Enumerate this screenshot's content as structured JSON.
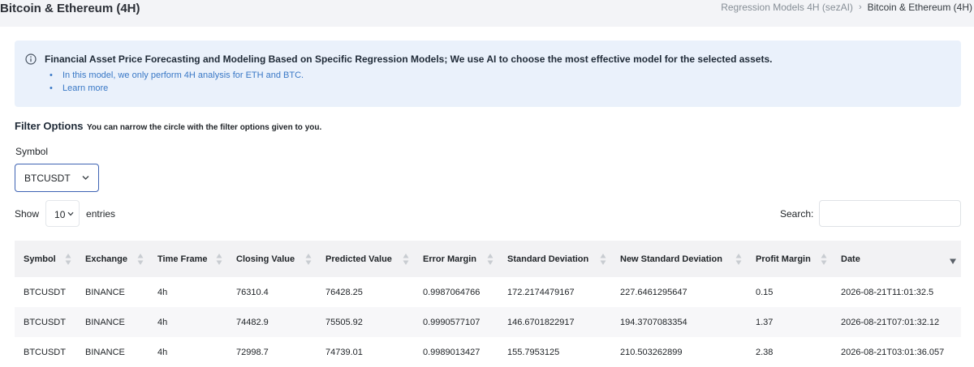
{
  "header": {
    "title": "Bitcoin & Ethereum (4H)",
    "breadcrumb": {
      "parent": "Regression Models 4H (sezAI)",
      "separator": "›",
      "current": "Bitcoin & Ethereum (4H)"
    }
  },
  "alert": {
    "icon": "info-circle-icon",
    "title": "Financial Asset Price Forecasting and Modeling Based on Specific Regression Models; We use AI to choose the most effective model for the selected assets.",
    "items": [
      "In this model, we only perform 4H analysis for ETH and BTC.",
      "Learn more"
    ]
  },
  "filter": {
    "title": "Filter Options",
    "description": "You can narrow the circle with the filter options given to you.",
    "symbol_label": "Symbol",
    "symbol_value": "BTCUSDT"
  },
  "table_controls": {
    "show_label": "Show",
    "page_length": "10",
    "entries_label": "entries",
    "search_label": "Search:",
    "search_value": ""
  },
  "table": {
    "columns": [
      "Symbol",
      "Exchange",
      "Time Frame",
      "Closing Value",
      "Predicted Value",
      "Error Margin",
      "Standard Deviation",
      "New Standard Deviation",
      "Profit Margin",
      "Date"
    ],
    "rows": [
      [
        "BTCUSDT",
        "BINANCE",
        "4h",
        "76310.4",
        "76428.25",
        "0.9987064766",
        "172.2174479167",
        "227.6461295647",
        "0.15",
        "2026-08-21T11:01:32.5"
      ],
      [
        "BTCUSDT",
        "BINANCE",
        "4h",
        "74482.9",
        "75505.92",
        "0.9990577107",
        "146.6701822917",
        "194.3707083354",
        "1.37",
        "2026-08-21T07:01:32.12"
      ],
      [
        "BTCUSDT",
        "BINANCE",
        "4h",
        "72998.7",
        "74739.01",
        "0.9989013427",
        "155.7953125",
        "210.503262899",
        "2.38",
        "2026-08-21T03:01:36.057"
      ]
    ],
    "sorted_column": "Date",
    "sort_direction": "desc"
  },
  "colors": {
    "alert_bg": "#eaf1fb",
    "link": "#3978c6",
    "select_border": "#3e63b3",
    "header_bg": "#f2f2f4"
  }
}
